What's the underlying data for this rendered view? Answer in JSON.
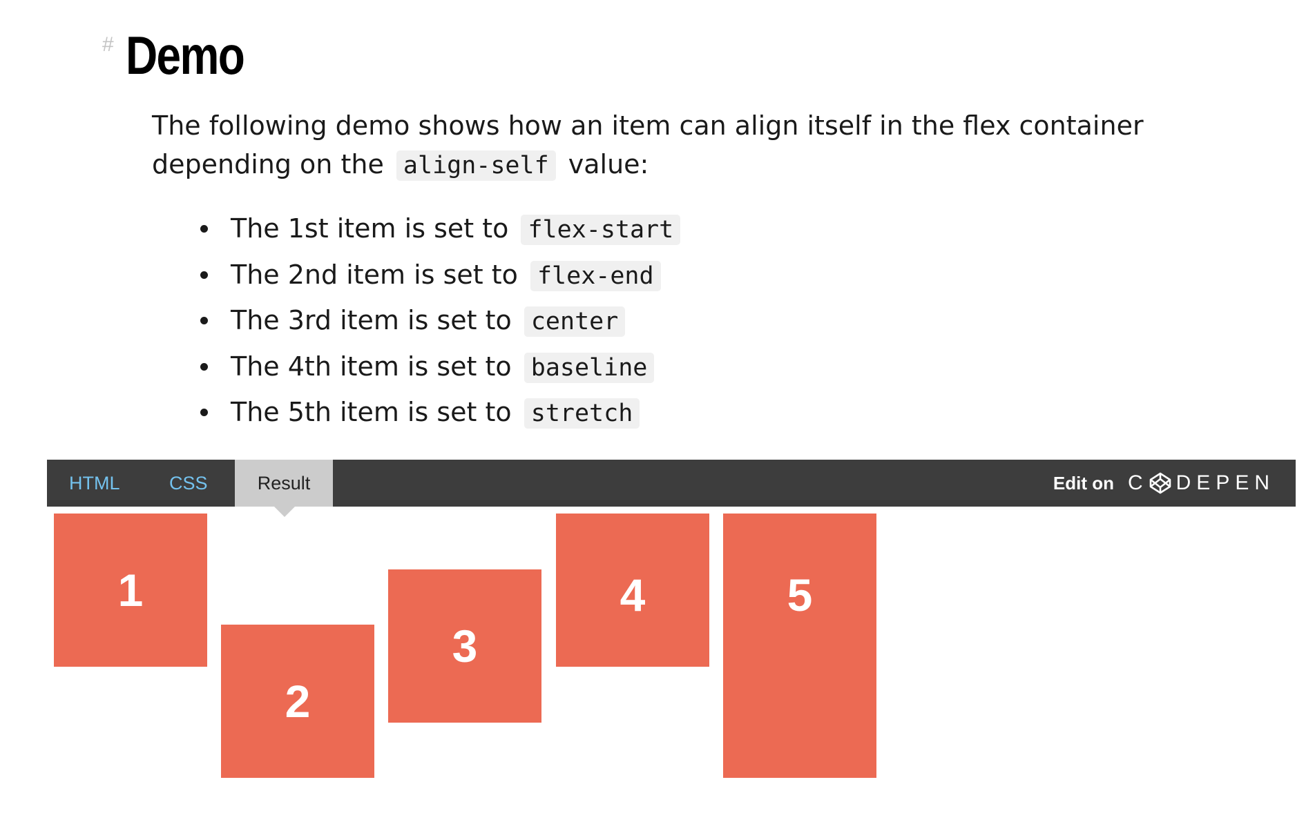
{
  "heading": {
    "anchor": "#",
    "title": "Demo"
  },
  "intro": {
    "text_before": "The following demo shows how an item can align itself in the flex container depending on the",
    "code": "align-self",
    "text_after": "value:"
  },
  "bullets": [
    {
      "text": "The 1st item is set to",
      "code": "flex-start"
    },
    {
      "text": "The 2nd item is set to",
      "code": "flex-end"
    },
    {
      "text": "The 3rd item is set to",
      "code": "center"
    },
    {
      "text": "The 4th item is set to",
      "code": "baseline"
    },
    {
      "text": "The 5th item is set to",
      "code": "stretch"
    }
  ],
  "codepen": {
    "tabs": [
      "HTML",
      "CSS",
      "Result"
    ],
    "active_tab": "Result",
    "edit_label": "Edit on",
    "logo_text": "C",
    "logo_rest": "DEPEN",
    "tab_link_color": "#74c2ee",
    "bar_color": "#3d3d3d"
  },
  "result": {
    "box_color": "#ec6a53",
    "items": [
      "1",
      "2",
      "3",
      "4",
      "5"
    ]
  }
}
